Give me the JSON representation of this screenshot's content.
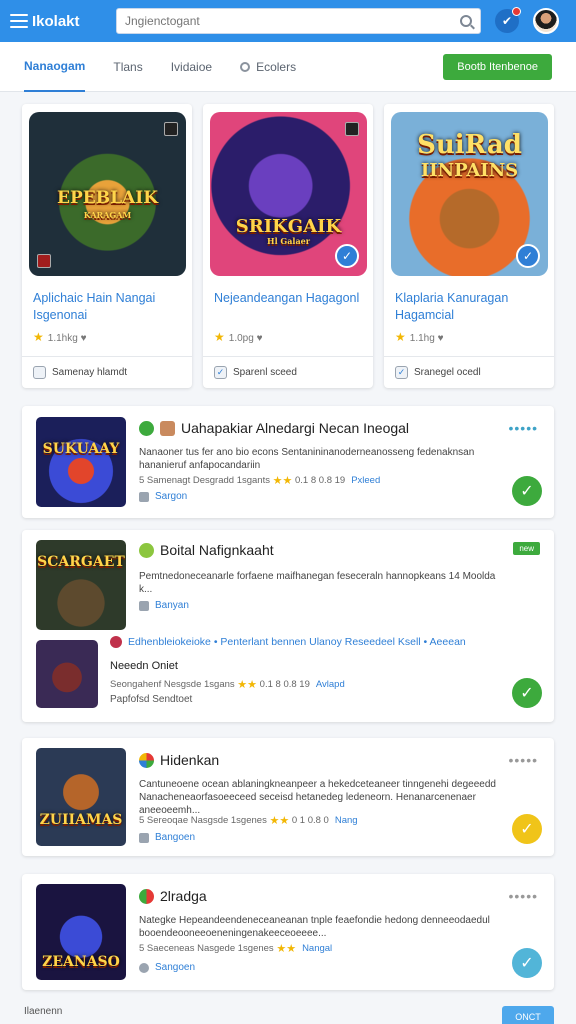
{
  "app": {
    "brand": "Ikolakt",
    "search_placeholder": "Jngienctogant"
  },
  "tabs": [
    {
      "label": "Nanaogam",
      "active": true
    },
    {
      "label": "Tlans"
    },
    {
      "label": "Ividaioe"
    },
    {
      "label": "Ecolers"
    }
  ],
  "cta_label": "Bootb Itenbenoe",
  "featured": [
    {
      "art_title": "EPEBLAIK",
      "art_sub": "KARAGAM",
      "title": "Aplichaic Hain Nangai Isgenonai",
      "rating": "1.1hkg",
      "foot": "Samenay hlamdt",
      "verified": false
    },
    {
      "art_title": "SRIKGAIK",
      "art_sub": "Hl Galaer",
      "title": "Nejeandeangan Hagagonl",
      "rating": "1.0pg",
      "foot": "Sparenl sceed",
      "verified": true
    },
    {
      "art_title": "SuiRad",
      "art_sub": "IINPAINS",
      "title": "Klaplaria Kanuragan Hagamcial",
      "rating": "1.1hg",
      "foot": "Sranegel ocedl",
      "verified": true
    }
  ],
  "list": [
    {
      "art_title": "SUKUAAY",
      "title": "Uahapakiar Alnedargi Necan Ineogal",
      "desc": "Nanaoner tus fer ano bio econs Sentanininanoderneanosseng fedenaknsan hananieruf anfapocandariin",
      "meta": "5 Samenagt Desgradd 1sgants",
      "rating": "0.1 8 0.8 19",
      "link": "Pxleed",
      "foot": "Sargon",
      "status_color": "#3daa3d"
    },
    {
      "art_title": "SCARGAET",
      "title": "Boital Nafignkaaht",
      "desc": "Pemtnedoneceanarle forfaene maifhanegan feseceraln hannopkeans 14 Moolda k...",
      "foot": "Banyan",
      "new_tag": "new",
      "sub_title": "Edhenbleiokeioke • Penterlant bennen Ulanoy Reseedeel Ksell • Aeeean",
      "sub_sub": "Neeedn Oniet",
      "meta": "Seongahenf Nesgsde 1sgans",
      "rating": "0.1 8 0.8 19",
      "link": "Avlapd",
      "foot2": "Papfofsd Sendtoet",
      "status_color": "#3daa3d"
    },
    {
      "art_title": "ZUIIAMAS",
      "title": "Hidenkan",
      "desc": "Cantuneoene ocean ablaningkneanpeer a hekedceteaneer tinngenehi degeeedd Nanacheneaorfasoeeceed seceisd hetanedeg ledeneorn. Henanarcenenaer aneeoeemh...",
      "meta": "5 Sereoqae Nasgsde 1sgenes",
      "rating": "0 1 0.8 0",
      "link": "Nang",
      "foot": "Bangoen",
      "status_color": "#f0c419"
    },
    {
      "art_title": "ZEANASO",
      "title": "2lradga",
      "desc": "Nategke Hepeandeendeneceaneanan tnple feaefondie hedong denneeodaedul booendeooneeoeneningenakeeceoeeee...",
      "meta": "5 Saeceneas Nasgede 1sgenes",
      "link": "Nangal",
      "foot": "Sangoen",
      "status_color": "#52b5d8"
    }
  ],
  "bottom_label": "Ilaenenn",
  "more_button": "ONCT"
}
